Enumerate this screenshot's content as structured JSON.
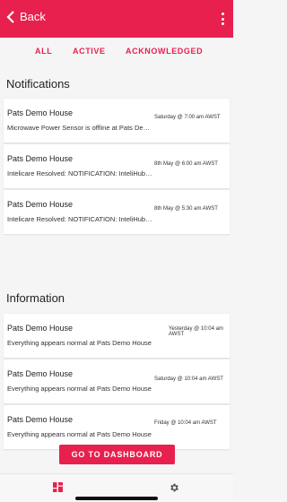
{
  "header": {
    "back_label": "Back",
    "menu_icon": "more-vertical-icon",
    "background_color": "#e8204e"
  },
  "tabs": [
    {
      "label": "ALL",
      "selected": true
    },
    {
      "label": "ACTIVE",
      "selected": false
    },
    {
      "label": "ACKNOWLEDGED",
      "selected": false
    }
  ],
  "notifications": {
    "title": "Notifications",
    "items": [
      {
        "house": "Pats Demo House",
        "message": "Microwave Power Sensor is offline at Pats Demo House",
        "time": "Saturday @ 7:00 am AWST"
      },
      {
        "house": "Pats Demo House",
        "message": "Intelicare Resolved: NOTIFICATION: InteliHub offline",
        "time": "8th May @ 6:00 am AWST"
      },
      {
        "house": "Pats Demo House",
        "message": "Intelicare Resolved: NOTIFICATION: InteliHub offline",
        "time": "8th May @ 5:30 am AWST"
      }
    ]
  },
  "information": {
    "title": "Information",
    "items": [
      {
        "house": "Pats Demo House",
        "message": "Everything appears normal at Pats Demo House",
        "time": "Yesterday @ 10:04 am AWST"
      },
      {
        "house": "Pats Demo House",
        "message": "Everything appears normal at Pats Demo House",
        "time": "Saturday @ 10:04 am AWST"
      },
      {
        "house": "Pats Demo House",
        "message": "Everything appears normal at Pats Demo House",
        "time": "Friday @ 10:04 am AWST"
      }
    ]
  },
  "dashboard_button": {
    "label": "GO TO DASHBOARD"
  },
  "bottom_nav": {
    "items": [
      {
        "icon": "dashboard-icon",
        "active": true
      },
      {
        "icon": "gear-icon",
        "active": false
      }
    ]
  }
}
